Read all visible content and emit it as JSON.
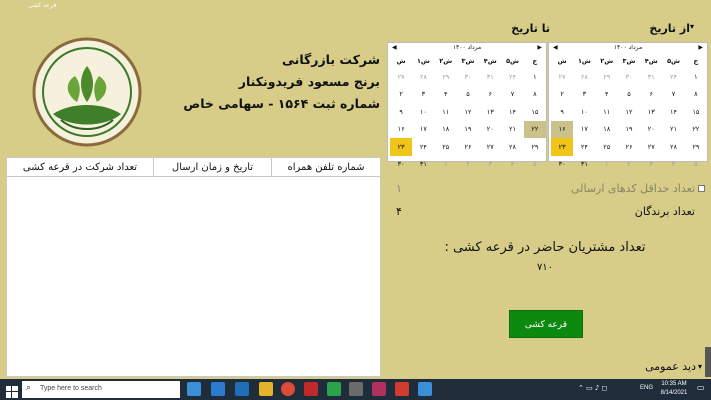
{
  "window": {
    "title": "قرعه کشی"
  },
  "company": {
    "line1": "شرکت بازرگانی",
    "line2": "برنج مسعود فریدونکنار",
    "line3": "شماره ثبت ۱۵۶۴ - سهامی خاص"
  },
  "date_range": {
    "from_label": "از تاریخ",
    "to_label": "تا تاریخ"
  },
  "calendars": {
    "month_label": "مرداد ۱۴۰۰",
    "days": [
      "ش",
      "۱ش",
      "۲ش",
      "۳ش",
      "۴ش",
      "۵ش",
      "ج"
    ],
    "from_weeks": [
      [
        "۲۷",
        "۲۸",
        "۲۹",
        "۳۰",
        "۳۱",
        "۲۴",
        "۱"
      ],
      [
        "۲",
        "۳",
        "۴",
        "۵",
        "۶",
        "۷",
        "۸"
      ],
      [
        "۹",
        "۱۰",
        "۱۱",
        "۱۲",
        "۱۳",
        "۱۴",
        "۱۵"
      ],
      [
        "۱۶",
        "۱۷",
        "۱۸",
        "۱۹",
        "۲۰",
        "۲۱",
        "۲۲"
      ],
      [
        "۲۳",
        "۲۴",
        "۲۵",
        "۲۶",
        "۲۷",
        "۲۸",
        "۲۹"
      ],
      [
        "۳۰",
        "۳۱",
        "۱",
        "۲",
        "۳",
        "۴",
        "۵"
      ]
    ],
    "to_weeks": [
      [
        "۲۷",
        "۲۸",
        "۲۹",
        "۳۰",
        "۳۱",
        "۲۴",
        "۱"
      ],
      [
        "۲",
        "۳",
        "۴",
        "۵",
        "۶",
        "۷",
        "۸"
      ],
      [
        "۹",
        "۱۰",
        "۱۱",
        "۱۲",
        "۱۳",
        "۱۴",
        "۱۵"
      ],
      [
        "۱۶",
        "۱۷",
        "۱۸",
        "۱۹",
        "۲۰",
        "۲۱",
        "۲۲"
      ],
      [
        "۲۳",
        "۲۴",
        "۲۵",
        "۲۶",
        "۲۷",
        "۲۸",
        "۲۹"
      ],
      [
        "۳۰",
        "۳۱",
        "۱",
        "۲",
        "۳",
        "۴",
        "۵"
      ]
    ],
    "from_selected": "۱۶",
    "from_today": "۲۳",
    "to_selected": "۲۲",
    "to_today": "۲۳"
  },
  "table": {
    "columns": [
      "شماره تلفن همراه",
      "تاریخ و زمان ارسال",
      "تعداد شرکت در قرعه کشی"
    ],
    "rows": []
  },
  "options": {
    "min_codes_label": "تعداد حداقل کدهای ارسالی",
    "min_codes_value": "۱",
    "winners_label": "تعداد برندگان",
    "winners_value": "۴"
  },
  "attendees": {
    "label": "تعداد مشتریان حاضر در قرعه کشی :",
    "value": "۷۱۰"
  },
  "draw_button": {
    "label": "قرعه کشی"
  },
  "overview": {
    "label": "دید عمومی"
  },
  "taskbar": {
    "search_placeholder": "Type here to search",
    "time": "10:35 AM",
    "date": "8/14/2021",
    "lang": "ENG"
  }
}
